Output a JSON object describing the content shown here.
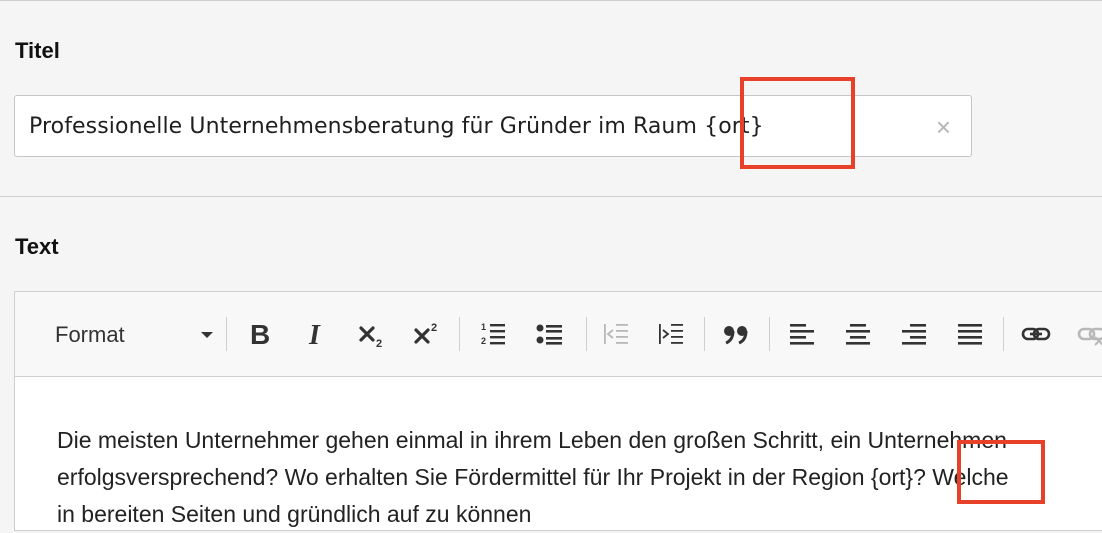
{
  "title_field": {
    "label": "Titel",
    "value": "Professionelle Unternehmensberatung für Gründer im Raum {ort}",
    "clear_symbol": "×"
  },
  "text_field": {
    "label": "Text"
  },
  "toolbar": {
    "format_label": "Format",
    "buttons": [
      {
        "name": "bold",
        "icon": "bold-icon"
      },
      {
        "name": "italic",
        "icon": "italic-icon"
      },
      {
        "name": "subscript",
        "icon": "subscript-icon"
      },
      {
        "name": "superscript",
        "icon": "superscript-icon"
      },
      {
        "name": "numbered-list",
        "icon": "numbered-list-icon"
      },
      {
        "name": "bulleted-list",
        "icon": "bulleted-list-icon"
      },
      {
        "name": "outdent",
        "icon": "outdent-icon",
        "disabled": true
      },
      {
        "name": "indent",
        "icon": "indent-icon"
      },
      {
        "name": "blockquote",
        "icon": "blockquote-icon"
      },
      {
        "name": "align-left",
        "icon": "align-left-icon"
      },
      {
        "name": "align-center",
        "icon": "align-center-icon"
      },
      {
        "name": "align-right",
        "icon": "align-right-icon"
      },
      {
        "name": "align-justify",
        "icon": "align-justify-icon"
      },
      {
        "name": "link",
        "icon": "link-icon"
      },
      {
        "name": "unlink",
        "icon": "unlink-icon",
        "disabled": true
      }
    ]
  },
  "editor_content": {
    "lines": [
      "Die meisten Unternehmer gehen einmal in ihrem Leben den großen Schritt, ein Unternehmen",
      "erfolgsversprechend? Wo erhalten Sie Fördermittel für Ihr Projekt in der Region {ort}? Welche",
      "in bereiten Seiten und gründlich auf zu können"
    ]
  },
  "colors": {
    "highlight": "#e8412a",
    "page_background": "#f5f5f5",
    "toolbar_icon": "#333333",
    "disabled_icon": "#b8b8b8"
  }
}
